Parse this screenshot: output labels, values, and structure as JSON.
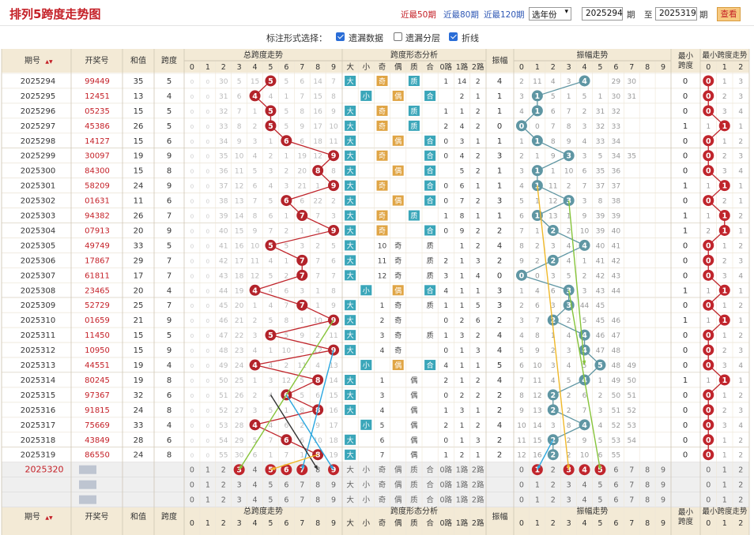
{
  "page": {
    "title": "排列5跨度走势图",
    "links": [
      "近最50期",
      "近最80期",
      "近最120期"
    ],
    "year_select": "选年份",
    "from": "2025294",
    "from_label": "期",
    "to_label": "至",
    "to": "2025319",
    "to_suffix": "期",
    "query_button": "查看",
    "option_label": "标注形式选择：",
    "options": [
      {
        "label": "遗漏数据",
        "checked": true
      },
      {
        "label": "遗漏分层",
        "checked": false
      },
      {
        "label": "折线",
        "checked": true
      }
    ]
  },
  "headers": {
    "issue": "期号",
    "sort_icon": "▲▼",
    "number": "开奖号",
    "sum": "和值",
    "span": "跨度",
    "span_trend": "总跨度走势",
    "shape": "跨度形态分析",
    "amp": "振幅",
    "amp_trend": "振幅走势",
    "min_span": "最小跨度",
    "min_span_trend": "最小跨度走势",
    "shape_cols": [
      "大",
      "小",
      "奇",
      "偶",
      "质",
      "合",
      "0路",
      "1路",
      "2路"
    ],
    "digits": [
      "0",
      "1",
      "2",
      "3",
      "4",
      "5",
      "6",
      "7",
      "8",
      "9"
    ],
    "min_digits": [
      "0",
      "1",
      "2"
    ]
  },
  "chart_data": {
    "type": "table",
    "rows": [
      {
        "issue": "2025294",
        "number": "99449",
        "sum": "35",
        "span": "5",
        "span_cells": [
          "30",
          "5",
          "15",
          "5",
          "6",
          "14",
          "7",
          "1"
        ],
        "shape": [
          "大",
          "",
          "奇",
          "",
          "质",
          "",
          "1",
          "14",
          "2"
        ],
        "amp": "4",
        "amp_cells": [
          "2",
          "11",
          "4",
          "3",
          "",
          "29",
          "30"
        ],
        "min_span": "0",
        "min_span_cells": [
          "1",
          "3"
        ]
      },
      {
        "issue": "2025295",
        "number": "12451",
        "sum": "13",
        "span": "4",
        "span_cells": [
          "31",
          "6",
          "4",
          "1",
          "7",
          "15",
          "8",
          "2"
        ],
        "shape": [
          "",
          "小",
          "",
          "偶",
          "",
          "合",
          "",
          "2",
          "1"
        ],
        "amp": "1",
        "amp_cells": [
          "3",
          "5",
          "1",
          "5",
          "1",
          "30",
          "31"
        ],
        "min_span": "0",
        "min_span_cells": [
          "2",
          "3"
        ]
      },
      {
        "issue": "2025296",
        "number": "05235",
        "sum": "15",
        "span": "5",
        "span_cells": [
          "32",
          "7",
          "1",
          "5",
          "8",
          "16",
          "9",
          "3"
        ],
        "shape": [
          "大",
          "",
          "奇",
          "",
          "质",
          "",
          "1",
          "1",
          "2"
        ],
        "amp": "1",
        "amp_cells": [
          "4",
          "6",
          "7",
          "2",
          "31",
          "32"
        ],
        "min_span": "0",
        "min_span_cells": [
          "3",
          "4"
        ]
      },
      {
        "issue": "2025297",
        "number": "45386",
        "sum": "26",
        "span": "5",
        "span_cells": [
          "33",
          "8",
          "2",
          "5",
          "9",
          "17",
          "10",
          "4"
        ],
        "shape": [
          "大",
          "",
          "奇",
          "",
          "质",
          "",
          "2",
          "4",
          "2"
        ],
        "amp": "0",
        "amp_cells": [
          "0",
          "7",
          "8",
          "3",
          "32",
          "33"
        ],
        "min_span": "1",
        "min_span_cells": [
          "1",
          "1"
        ]
      },
      {
        "issue": "2025298",
        "number": "14127",
        "sum": "15",
        "span": "6",
        "span_cells": [
          "34",
          "9",
          "3",
          "1",
          "6",
          "18",
          "11",
          "5"
        ],
        "shape": [
          "大",
          "",
          "",
          "偶",
          "",
          "合",
          "0",
          "3",
          "1"
        ],
        "amp": "1",
        "amp_cells": [
          "1",
          "8",
          "9",
          "4",
          "33",
          "34"
        ],
        "min_span": "0",
        "min_span_cells": [
          "1",
          "2"
        ]
      },
      {
        "issue": "2025299",
        "number": "30097",
        "sum": "19",
        "span": "9",
        "span_cells": [
          "35",
          "10",
          "4",
          "2",
          "1",
          "19",
          "12",
          "9"
        ],
        "shape": [
          "大",
          "",
          "奇",
          "",
          "",
          "合",
          "0",
          "4",
          "2"
        ],
        "amp": "3",
        "amp_cells": [
          "2",
          "1",
          "9",
          "3",
          "5",
          "34",
          "35"
        ],
        "min_span": "0",
        "min_span_cells": [
          "2",
          "3"
        ]
      },
      {
        "issue": "2025300",
        "number": "84300",
        "sum": "15",
        "span": "8",
        "span_cells": [
          "36",
          "11",
          "5",
          "3",
          "2",
          "20",
          "8",
          "1"
        ],
        "shape": [
          "大",
          "",
          "",
          "偶",
          "",
          "合",
          "",
          "5",
          "2"
        ],
        "amp": "1",
        "amp_cells": [
          "3",
          "1",
          "10",
          "6",
          "35",
          "36"
        ],
        "min_span": "0",
        "min_span_cells": [
          "3",
          "4"
        ]
      },
      {
        "issue": "2025301",
        "number": "58209",
        "sum": "24",
        "span": "9",
        "span_cells": [
          "37",
          "12",
          "6",
          "4",
          "3",
          "21",
          "1",
          "9"
        ],
        "shape": [
          "大",
          "",
          "奇",
          "",
          "",
          "合",
          "0",
          "6",
          "1"
        ],
        "amp": "1",
        "amp_cells": [
          "4",
          "11",
          "2",
          "7",
          "37",
          "37"
        ],
        "min_span": "1",
        "min_span_cells": [
          "1",
          "1"
        ]
      },
      {
        "issue": "2025302",
        "number": "01631",
        "sum": "11",
        "span": "6",
        "span_cells": [
          "38",
          "13",
          "7",
          "5",
          "6",
          "22",
          "2",
          "1"
        ],
        "shape": [
          "大",
          "",
          "",
          "偶",
          "",
          "合",
          "0",
          "7",
          "2"
        ],
        "amp": "3",
        "amp_cells": [
          "5",
          "1",
          "12",
          "3",
          "8",
          "38"
        ],
        "min_span": "0",
        "min_span_cells": [
          "2",
          "1"
        ]
      },
      {
        "issue": "2025303",
        "number": "94382",
        "sum": "26",
        "span": "7",
        "span_cells": [
          "39",
          "14",
          "8",
          "6",
          "1",
          "7",
          "3",
          "2"
        ],
        "shape": [
          "大",
          "",
          "奇",
          "",
          "质",
          "",
          "1",
          "8",
          "1"
        ],
        "amp": "1",
        "amp_cells": [
          "6",
          "13",
          "1",
          "9",
          "39",
          "39"
        ],
        "min_span": "1",
        "min_span_cells": [
          "1",
          "2"
        ]
      },
      {
        "issue": "2025304",
        "number": "07913",
        "sum": "20",
        "span": "9",
        "span_cells": [
          "40",
          "15",
          "9",
          "7",
          "2",
          "1",
          "4",
          "9"
        ],
        "shape": [
          "大",
          "",
          "奇",
          "",
          "",
          "合",
          "0",
          "9",
          "2"
        ],
        "amp": "2",
        "amp_cells": [
          "7",
          "1",
          "2",
          "10",
          "39",
          "40"
        ],
        "min_span": "1",
        "min_span_cells": [
          "2",
          "1"
        ]
      },
      {
        "issue": "2025305",
        "number": "49749",
        "sum": "33",
        "span": "5",
        "span_cells": [
          "41",
          "16",
          "10",
          "5",
          "3",
          "2",
          "5",
          "1"
        ],
        "shape": [
          "大",
          "",
          "10",
          "奇",
          "",
          "质",
          "",
          "1",
          "2"
        ],
        "amp": "4",
        "amp_cells": [
          "8",
          "2",
          "3",
          "4",
          "40",
          "41"
        ],
        "min_span": "0",
        "min_span_cells": [
          "1",
          "2"
        ]
      },
      {
        "issue": "2025306",
        "number": "17867",
        "sum": "29",
        "span": "7",
        "span_cells": [
          "42",
          "17",
          "11",
          "4",
          "1",
          "7",
          "6",
          "2"
        ],
        "shape": [
          "大",
          "",
          "11",
          "奇",
          "",
          "质",
          "2",
          "1",
          "3"
        ],
        "amp": "2",
        "amp_cells": [
          "9",
          "2",
          "4",
          "1",
          "41",
          "42"
        ],
        "min_span": "0",
        "min_span_cells": [
          "2",
          "3"
        ]
      },
      {
        "issue": "2025307",
        "number": "61811",
        "sum": "17",
        "span": "7",
        "span_cells": [
          "43",
          "18",
          "12",
          "5",
          "2",
          "7",
          "7",
          "3"
        ],
        "shape": [
          "大",
          "",
          "12",
          "奇",
          "",
          "质",
          "3",
          "1",
          "4"
        ],
        "amp": "0",
        "amp_cells": [
          "0",
          "3",
          "5",
          "2",
          "42",
          "43"
        ],
        "min_span": "0",
        "min_span_cells": [
          "3",
          "4"
        ]
      },
      {
        "issue": "2025308",
        "number": "23465",
        "sum": "20",
        "span": "4",
        "span_cells": [
          "44",
          "19",
          "4",
          "6",
          "3",
          "1",
          "8",
          "4"
        ],
        "shape": [
          "",
          "小",
          "",
          "偶",
          "",
          "合",
          "4",
          "1",
          "1"
        ],
        "amp": "3",
        "amp_cells": [
          "1",
          "4",
          "6",
          "3",
          "43",
          "44"
        ],
        "min_span": "1",
        "min_span_cells": [
          "1",
          "1"
        ]
      },
      {
        "issue": "2025309",
        "number": "52729",
        "sum": "25",
        "span": "7",
        "span_cells": [
          "45",
          "20",
          "1",
          "4",
          "7",
          "1",
          "9",
          "5"
        ],
        "shape": [
          "大",
          "",
          "1",
          "奇",
          "",
          "质",
          "1",
          "1",
          "5"
        ],
        "amp": "3",
        "amp_cells": [
          "2",
          "6",
          "3",
          "44",
          "45"
        ],
        "min_span": "0",
        "min_span_cells": [
          "1",
          "2"
        ]
      },
      {
        "issue": "2025310",
        "number": "01659",
        "sum": "21",
        "span": "9",
        "span_cells": [
          "46",
          "21",
          "2",
          "5",
          "8",
          "1",
          "10",
          "9"
        ],
        "shape": [
          "大",
          "",
          "2",
          "奇",
          "",
          "",
          "0",
          "2",
          "6"
        ],
        "amp": "2",
        "amp_cells": [
          "3",
          "7",
          "2",
          "5",
          "45",
          "46"
        ],
        "min_span": "1",
        "min_span_cells": [
          "1",
          "1"
        ]
      },
      {
        "issue": "2025311",
        "number": "11450",
        "sum": "15",
        "span": "5",
        "span_cells": [
          "47",
          "22",
          "3",
          "5",
          "9",
          "2",
          "11",
          "1"
        ],
        "shape": [
          "大",
          "",
          "3",
          "奇",
          "",
          "质",
          "1",
          "3",
          "2"
        ],
        "amp": "4",
        "amp_cells": [
          "4",
          "8",
          "1",
          "4",
          "46",
          "47"
        ],
        "min_span": "0",
        "min_span_cells": [
          "1",
          "2"
        ]
      },
      {
        "issue": "2025312",
        "number": "10950",
        "sum": "15",
        "span": "9",
        "span_cells": [
          "48",
          "23",
          "4",
          "1",
          "10",
          "3",
          "12",
          "9"
        ],
        "shape": [
          "大",
          "",
          "4",
          "奇",
          "",
          "",
          "0",
          "1",
          "3"
        ],
        "amp": "4",
        "amp_cells": [
          "5",
          "9",
          "2",
          "3",
          "47",
          "48"
        ],
        "min_span": "0",
        "min_span_cells": [
          "2",
          "3"
        ]
      },
      {
        "issue": "2025313",
        "number": "44551",
        "sum": "19",
        "span": "4",
        "span_cells": [
          "49",
          "24",
          "4",
          "2",
          "11",
          "4",
          "13",
          "1"
        ],
        "shape": [
          "",
          "小",
          "",
          "偶",
          "",
          "合",
          "4",
          "1",
          "1"
        ],
        "amp": "5",
        "amp_cells": [
          "6",
          "10",
          "3",
          "4",
          "5",
          "48",
          "49"
        ],
        "min_span": "0",
        "min_span_cells": [
          "3",
          "4"
        ]
      },
      {
        "issue": "2025314",
        "number": "80245",
        "sum": "19",
        "span": "8",
        "span_cells": [
          "50",
          "25",
          "1",
          "3",
          "12",
          "5",
          "14",
          "8"
        ],
        "shape": [
          "大",
          "",
          "1",
          "",
          "偶",
          "",
          "2",
          "1",
          "2"
        ],
        "amp": "4",
        "amp_cells": [
          "7",
          "11",
          "4",
          "5",
          "1",
          "49",
          "50"
        ],
        "min_span": "1",
        "min_span_cells": [
          "1",
          "1"
        ]
      },
      {
        "issue": "2025315",
        "number": "97367",
        "sum": "32",
        "span": "6",
        "span_cells": [
          "51",
          "26",
          "2",
          "4",
          "5",
          "6",
          "15",
          "1"
        ],
        "shape": [
          "大",
          "",
          "3",
          "",
          "偶",
          "",
          "0",
          "2",
          "2"
        ],
        "amp": "2",
        "amp_cells": [
          "8",
          "12",
          "2",
          "6",
          "2",
          "50",
          "51"
        ],
        "min_span": "0",
        "min_span_cells": [
          "1",
          "2"
        ]
      },
      {
        "issue": "2025316",
        "number": "91815",
        "sum": "24",
        "span": "8",
        "span_cells": [
          "52",
          "27",
          "3",
          "5",
          "1",
          "8",
          "16",
          "2"
        ],
        "shape": [
          "大",
          "",
          "4",
          "",
          "偶",
          "",
          "1",
          "3",
          "1"
        ],
        "amp": "2",
        "amp_cells": [
          "9",
          "13",
          "2",
          "7",
          "3",
          "51",
          "52"
        ],
        "min_span": "0",
        "min_span_cells": [
          "2",
          "3"
        ]
      },
      {
        "issue": "2025317",
        "number": "75669",
        "sum": "33",
        "span": "4",
        "span_cells": [
          "53",
          "28",
          "4",
          "6",
          "2",
          "9",
          "17",
          "3"
        ],
        "shape": [
          "",
          "小",
          "5",
          "",
          "偶",
          "",
          "2",
          "1",
          "2"
        ],
        "amp": "4",
        "amp_cells": [
          "10",
          "14",
          "3",
          "8",
          "4",
          "52",
          "53"
        ],
        "min_span": "0",
        "min_span_cells": [
          "3",
          "4"
        ]
      },
      {
        "issue": "2025318",
        "number": "43849",
        "sum": "28",
        "span": "6",
        "span_cells": [
          "54",
          "29",
          "5",
          "7",
          "6",
          "10",
          "18",
          "4"
        ],
        "shape": [
          "大",
          "",
          "6",
          "",
          "偶",
          "",
          "0",
          "1",
          "3"
        ],
        "amp": "2",
        "amp_cells": [
          "11",
          "15",
          "2",
          "9",
          "5",
          "53",
          "54"
        ],
        "min_span": "0",
        "min_span_cells": [
          "1",
          "2"
        ]
      },
      {
        "issue": "2025319",
        "number": "86550",
        "sum": "24",
        "span": "8",
        "span_cells": [
          "55",
          "30",
          "6",
          "1",
          "7",
          "1",
          "19",
          "8"
        ],
        "shape": [
          "大",
          "",
          "7",
          "",
          "偶",
          "",
          "1",
          "2",
          "1"
        ],
        "amp": "2",
        "amp_cells": [
          "12",
          "16",
          "2",
          "10",
          "6",
          "55"
        ],
        "min_span": "0",
        "min_span_cells": [
          "1",
          "2"
        ]
      }
    ],
    "span_values": [
      5,
      4,
      5,
      5,
      6,
      9,
      8,
      9,
      6,
      7,
      9,
      5,
      7,
      7,
      4,
      7,
      9,
      5,
      9,
      4,
      8,
      6,
      8,
      4,
      6,
      8
    ],
    "amp_values": [
      4,
      1,
      1,
      0,
      1,
      3,
      1,
      1,
      3,
      1,
      2,
      4,
      2,
      0,
      3,
      3,
      2,
      4,
      4,
      5,
      4,
      2,
      2,
      4,
      2,
      2
    ],
    "min_values": [
      0,
      0,
      0,
      1,
      0,
      0,
      0,
      1,
      0,
      1,
      1,
      0,
      0,
      0,
      1,
      0,
      1,
      0,
      0,
      0,
      1,
      0,
      0,
      0,
      0,
      0
    ],
    "next_issue": "2025320",
    "predict_span_circles": [
      "3",
      "5",
      "6",
      "7",
      "9"
    ],
    "predict_amp_circles": [
      "1",
      "3",
      "4",
      "5"
    ]
  }
}
